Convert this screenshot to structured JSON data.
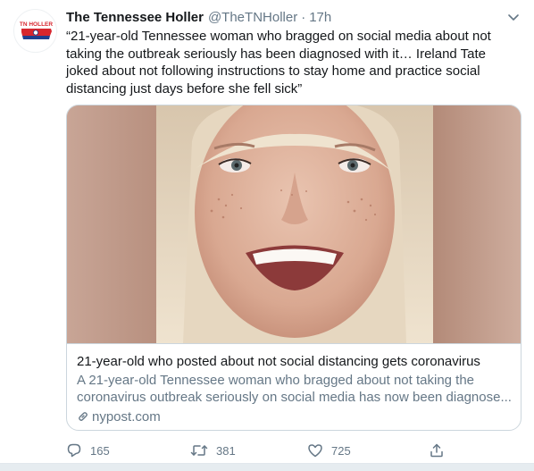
{
  "tweet": {
    "avatar_logo_text": "TN HOLLER",
    "display_name": "The Tennessee Holler",
    "handle": "@TheTNHoller",
    "separator": "·",
    "time": "17h",
    "text": "“21-year-old Tennessee woman who bragged on social media about not taking the outbreak seriously has been diagnosed with it… Ireland Tate joked about not following instructions to stay home and practice social distancing just days before she fell sick”"
  },
  "card": {
    "image_alt": "Young woman with blonde hair smiling at camera",
    "title": "21-year-old who posted about not social distancing gets coronavirus",
    "description": "A 21-year-old Tennessee woman who bragged about not taking the coronavirus outbreak seriously on social media has now been diagnose...",
    "domain": "nypost.com"
  },
  "actions": {
    "reply_count": "165",
    "retweet_count": "381",
    "like_count": "725"
  },
  "colors": {
    "text_primary": "#14171a",
    "text_secondary": "#657786",
    "border": "#ccd6dd",
    "logo_red": "#d7262e",
    "logo_blue": "#1f3f8f"
  },
  "icons": {
    "caret": "chevron-down-icon",
    "link": "link-icon",
    "reply": "reply-icon",
    "retweet": "retweet-icon",
    "like": "heart-icon",
    "share": "share-icon"
  }
}
